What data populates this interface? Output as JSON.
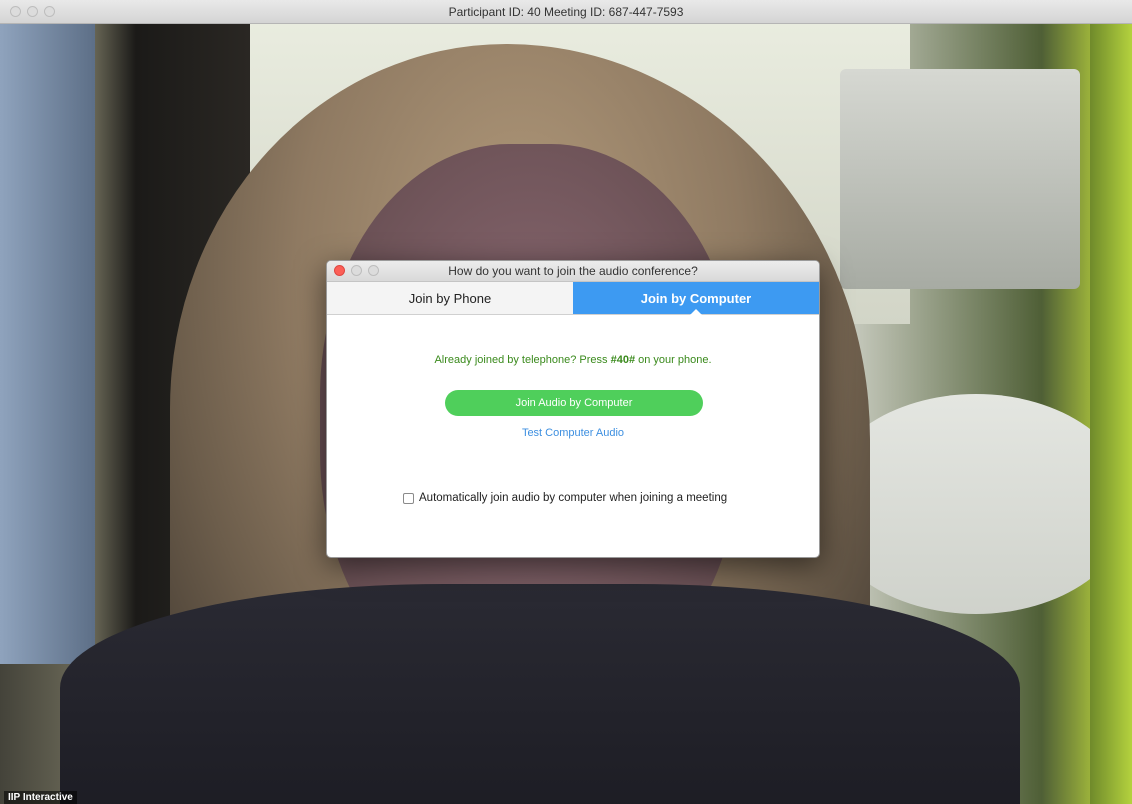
{
  "window": {
    "title": "Participant ID: 40   Meeting ID: 687-447-7593"
  },
  "video": {
    "label": "IIP Interactive"
  },
  "dialog": {
    "title": "How do you want to join the audio conference?",
    "tabs": [
      {
        "label": "Join by Phone",
        "active": false
      },
      {
        "label": "Join by Computer",
        "active": true
      }
    ],
    "notice_prefix": "Already joined by telephone? Press ",
    "notice_code": "#40#",
    "notice_suffix": " on your phone.",
    "join_button": "Join Audio by Computer",
    "test_link": "Test Computer Audio",
    "auto_join_label": "Automatically join audio by computer when joining a meeting",
    "auto_join_checked": false
  },
  "colors": {
    "accent": "#3d9af2",
    "join_button": "#4fcf5b",
    "notice_text": "#3a8a1c",
    "link": "#3d8fe0",
    "close_light": "#fc5f57"
  }
}
